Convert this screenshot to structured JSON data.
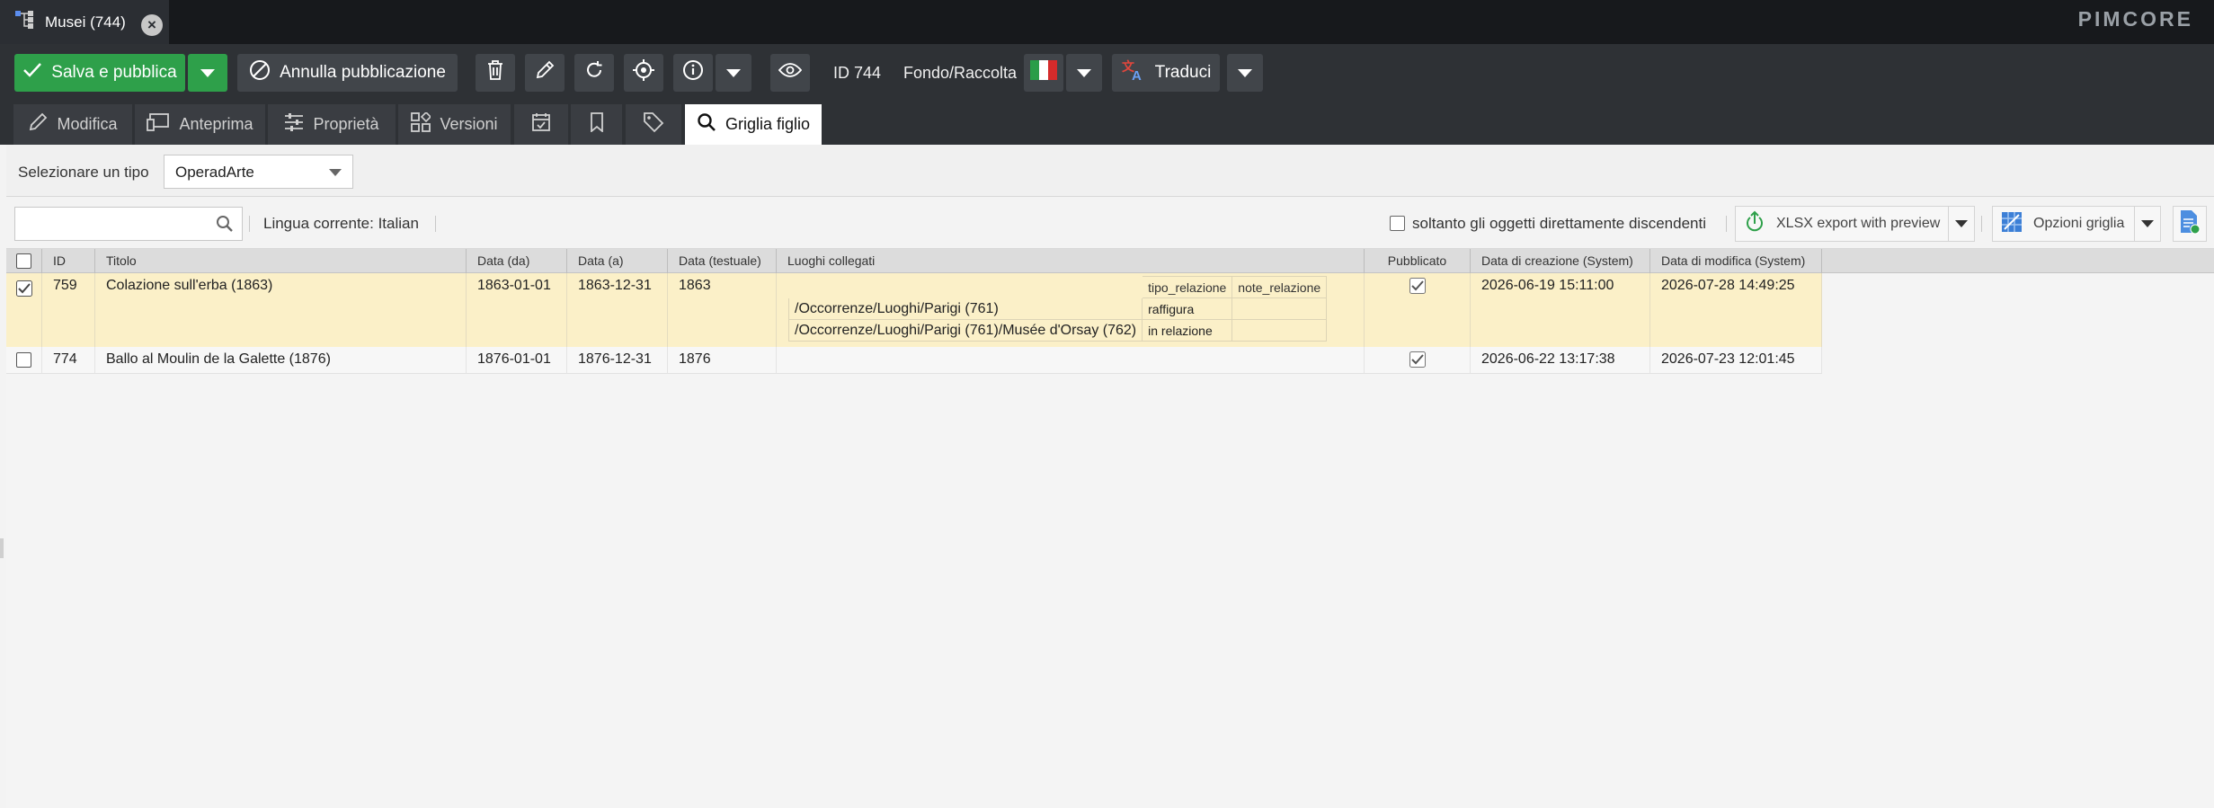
{
  "tab": {
    "title": "Musei (744)",
    "close_icon": "close-icon",
    "tree_icon": "object-tree-icon"
  },
  "brand": "PIMCORE",
  "toolbar": {
    "save_publish": "Salva e pubblica",
    "unpublish": "Annulla pubblicazione",
    "id_label": "ID 744",
    "type_label": "Fondo/Raccolta",
    "translate": "Traduci",
    "language_flag": "italian-flag-icon"
  },
  "subtabs": {
    "edit": "Modifica",
    "preview": "Anteprima",
    "properties": "Proprietà",
    "versions": "Versioni",
    "child_grid": "Griglia figlio"
  },
  "type_selector": {
    "label": "Selezionare un tipo",
    "value": "OperadArte"
  },
  "filters": {
    "search_placeholder": "",
    "current_language": "Lingua corrente: Italian",
    "only_direct_children": "soltanto gli oggetti direttamente discendenti",
    "xlsx_export": "XLSX export with preview",
    "grid_options": "Opzioni griglia"
  },
  "grid": {
    "columns": [
      "ID",
      "Titolo",
      "Data (da)",
      "Data (a)",
      "Data (testuale)",
      "Luoghi collegati",
      "Pubblicato",
      "Data di creazione (System)",
      "Data di modifica (System)"
    ],
    "rows": [
      {
        "checked": true,
        "id": "759",
        "title": "Colazione sull'erba (1863)",
        "date_from": "1863-01-01",
        "date_to": "1863-12-31",
        "date_text": "1863",
        "places": {
          "headers": [
            "tipo_relazione",
            "note_relazione"
          ],
          "items": [
            {
              "path": "/Occorrenze/Luoghi/Parigi (761)",
              "tipo_relazione": "raffigura",
              "note_relazione": ""
            },
            {
              "path": "/Occorrenze/Luoghi/Parigi (761)/Musée d'Orsay (762)",
              "tipo_relazione": "in relazione",
              "note_relazione": ""
            }
          ]
        },
        "published": true,
        "created": "2026-06-19 15:11:00",
        "modified": "2026-07-28 14:49:25"
      },
      {
        "checked": false,
        "id": "774",
        "title": "Ballo al Moulin de la Galette (1876)",
        "date_from": "1876-01-01",
        "date_to": "1876-12-31",
        "date_text": "1876",
        "published": true,
        "created": "2026-06-22 13:17:38",
        "modified": "2026-07-23 12:01:45"
      }
    ]
  },
  "colors": {
    "accent_green": "#2ea04a",
    "toolbar_bg": "#2e3135",
    "topbar_bg": "#17191c",
    "selected_row": "#fbf0c8"
  }
}
